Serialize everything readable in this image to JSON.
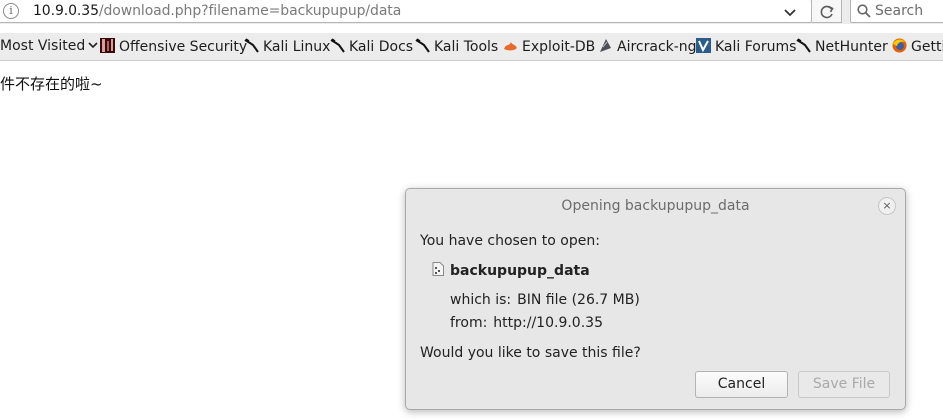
{
  "navbar": {
    "url_host": "10.9.0.35",
    "url_path": "/download.php?filename=backupupup/data",
    "search_placeholder": "Search",
    "info_symbol": "i"
  },
  "bookmarks": {
    "most_visited": "Most Visited",
    "items": [
      {
        "label": "Offensive Security",
        "icon": "offensive-security-icon"
      },
      {
        "label": "Kali Linux",
        "icon": "kali-dragon-icon"
      },
      {
        "label": "Kali Docs",
        "icon": "kali-dragon-icon"
      },
      {
        "label": "Kali Tools",
        "icon": "kali-dragon-icon"
      },
      {
        "label": "Exploit-DB",
        "icon": "exploit-db-icon"
      },
      {
        "label": "Aircrack-ng",
        "icon": "aircrack-icon"
      },
      {
        "label": "Kali Forums",
        "icon": "kali-forums-icon"
      },
      {
        "label": "NetHunter",
        "icon": "kali-dragon-icon"
      },
      {
        "label": "Getting Started",
        "icon": "firefox-icon"
      }
    ]
  },
  "page": {
    "message": "件不存在的啦~"
  },
  "dialog": {
    "title": "Opening backupupup_data",
    "chosen_label": "You have chosen to open:",
    "file_name": "backupupup_data",
    "which_is_label": "which is:",
    "which_is_value": "BIN file (26.7 MB)",
    "from_label": "from:",
    "from_value": "http://10.9.0.35",
    "question": "Would you like to save this file?",
    "cancel_label": "Cancel",
    "save_label": "Save File",
    "close_symbol": "×"
  },
  "colors": {
    "toolbar_bg": "#ececec",
    "dialog_bg": "#e7e7e7",
    "disabled_text": "#a9a9a9"
  }
}
